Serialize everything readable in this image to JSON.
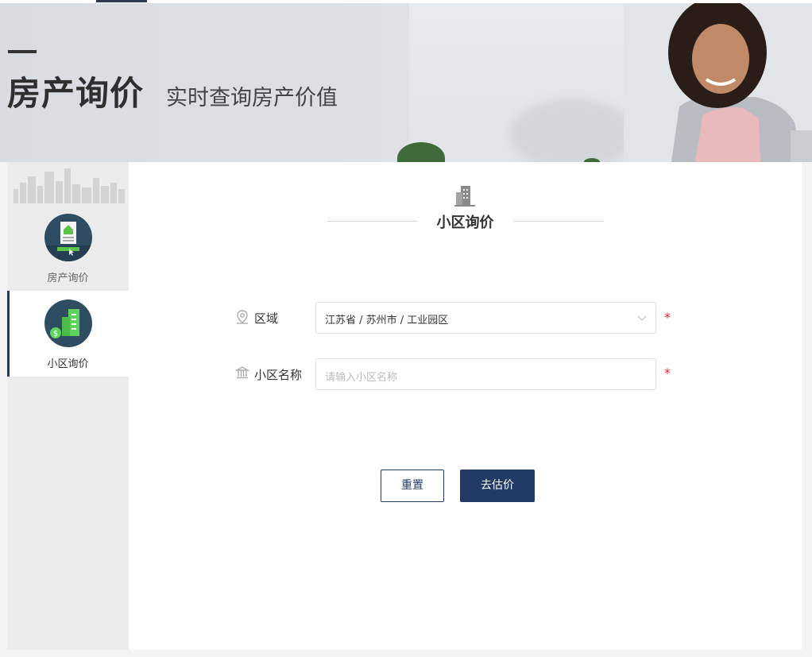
{
  "banner": {
    "title": "房产询价",
    "subtitle": "实时查询房产价值"
  },
  "sidebar": {
    "items": [
      {
        "label": "房产询价",
        "icon": "house-document-icon",
        "active": false
      },
      {
        "label": "小区询价",
        "icon": "buildings-price-icon",
        "active": true
      }
    ]
  },
  "main": {
    "section_title": "小区询价",
    "form": {
      "region": {
        "label": "区域",
        "value": "江苏省 / 苏州市 / 工业园区",
        "required": "*"
      },
      "community": {
        "label": "小区名称",
        "placeholder": "请输入小区名称",
        "required": "*"
      }
    },
    "buttons": {
      "reset": "重置",
      "submit": "去估价"
    }
  },
  "colors": {
    "primary": "#213a66",
    "required": "#e0262b",
    "sidebar_bg": "#ececec"
  }
}
